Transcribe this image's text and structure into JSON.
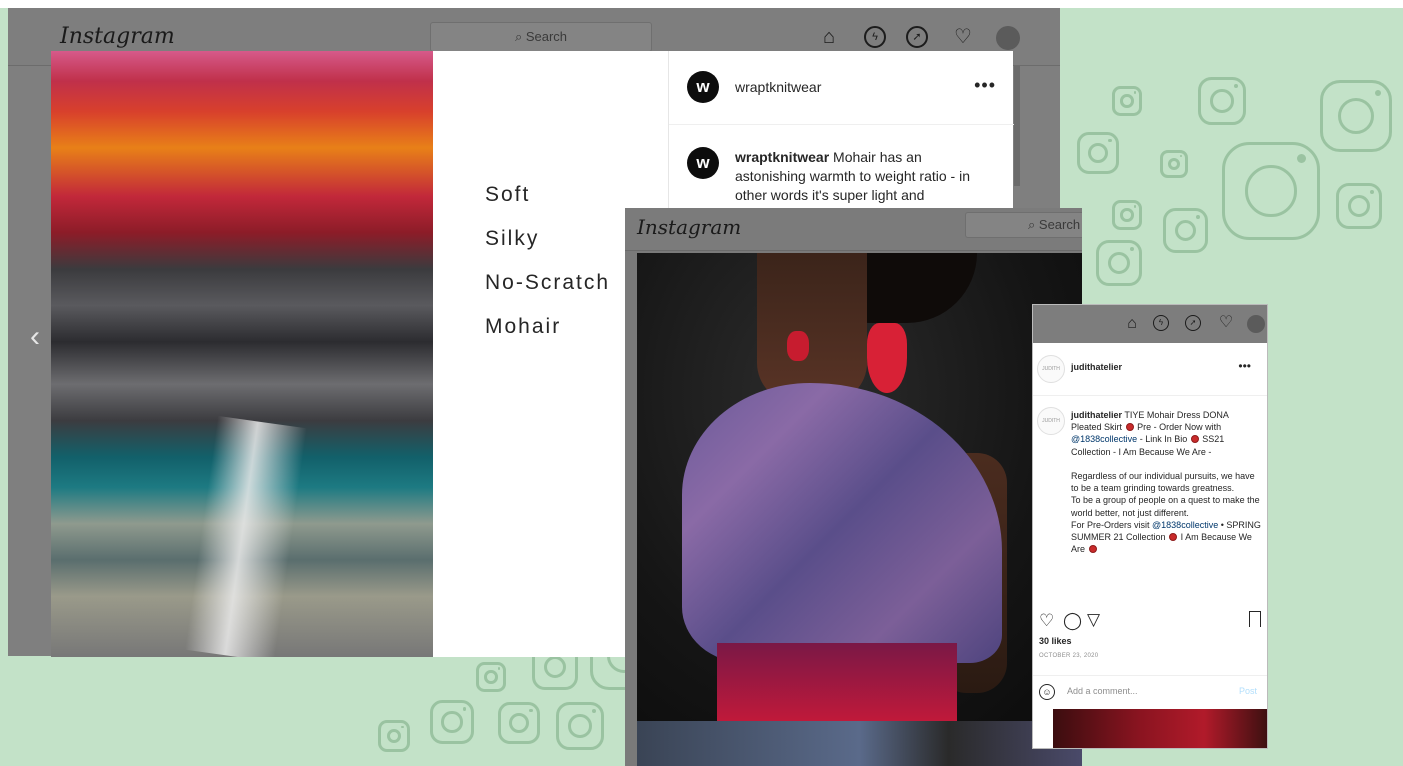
{
  "window1": {
    "app_name": "Instagram",
    "search_placeholder": "Search",
    "nav_icons": [
      "home-icon",
      "messenger-icon",
      "explore-icon",
      "heart-icon",
      "profile-avatar"
    ],
    "post": {
      "words": [
        "Soft",
        "Silky",
        "No-Scratch",
        "Mohair"
      ],
      "username": "wraptknitwear",
      "avatar_letter": "w",
      "more": "•••",
      "caption_user": "wraptknitwear",
      "caption_text": "Mohair has an astonishing warmth to weight ratio - in other words it's super light and"
    },
    "prev_arrow": "‹"
  },
  "window2": {
    "app_name": "Instagram",
    "search_placeholder": "Search"
  },
  "window3": {
    "nav_icons": [
      "home-icon",
      "messenger-icon",
      "explore-icon",
      "heart-icon",
      "profile-avatar"
    ],
    "username": "judithatelier",
    "more": "•••",
    "avatar_text": "JUDITH",
    "caption_user": "judithatelier",
    "caption_line1": "TIYE Mohair Dress DONA Pleated Skirt",
    "caption_line2": "Pre - Order Now with",
    "caption_mention1": "@1838collective",
    "caption_line3": "- Link In Bio",
    "caption_line4": "SS21 Collection - I Am Because We Are -",
    "caption_para2": "Regardless of our individual pursuits, we have to be a team grinding towards greatness.",
    "caption_para3": "To be a group of people on a quest to make the world better, not just different.",
    "caption_para4a": "For Pre-Orders visit",
    "caption_mention2": "@1838collective",
    "caption_para4b": "• SPRING SUMMER 21 Collection",
    "caption_para4c": "I Am Because We Are",
    "likes": "30 likes",
    "date": "OCTOBER 23, 2020",
    "comment_placeholder": "Add a comment...",
    "post_button": "Post"
  }
}
